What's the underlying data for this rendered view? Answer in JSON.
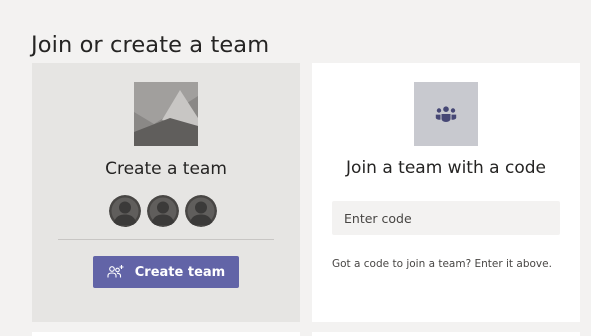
{
  "page": {
    "title": "Join or create a team"
  },
  "create_card": {
    "title": "Create a team",
    "button_label": "Create team",
    "image_icon": "landscape-image-icon",
    "avatar_icon": "person-avatar-icon",
    "avatar_count": 3,
    "button_icon": "people-add-icon"
  },
  "join_card": {
    "title": "Join a team with a code",
    "icon": "people-team-icon",
    "input_placeholder": "Enter code",
    "input_value": "",
    "hint": "Got a code to join a team? Enter it above."
  },
  "colors": {
    "accent": "#6264a7",
    "background": "#f3f2f1",
    "create_card_bg": "#e6e5e3",
    "join_card_bg": "#ffffff"
  }
}
